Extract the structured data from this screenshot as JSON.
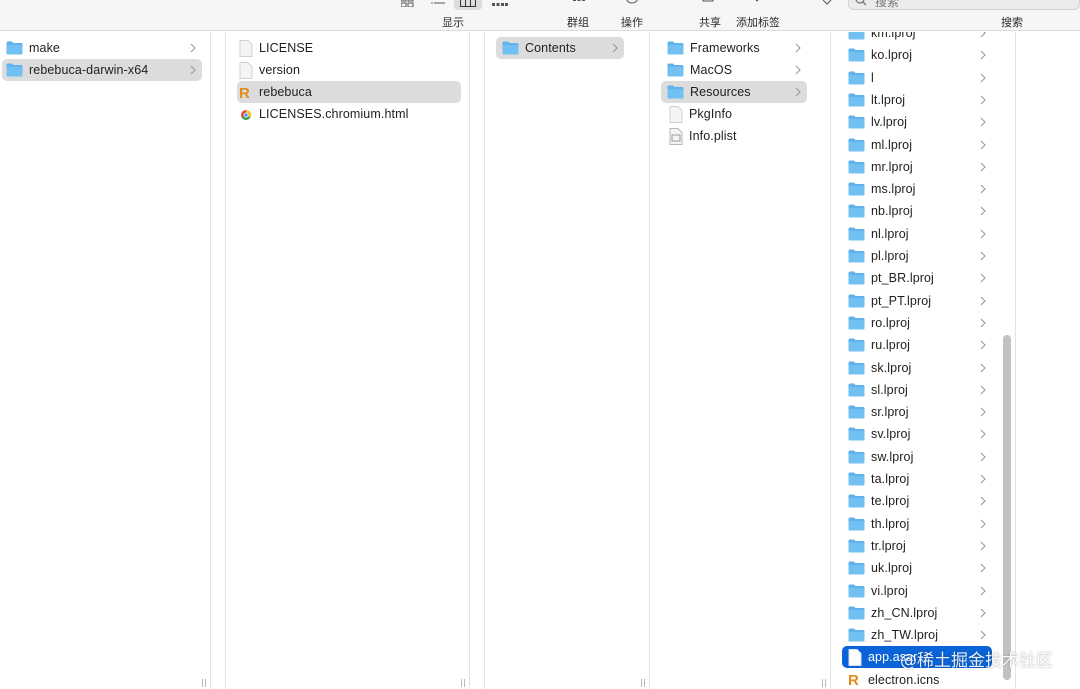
{
  "toolbar": {
    "view_label": "显示",
    "group_label": "群组",
    "action_label": "操作",
    "share_label": "共享",
    "tag_label": "添加标签",
    "search_label": "搜索",
    "search_placeholder": "搜索"
  },
  "columns": {
    "c1": [
      "make",
      "rebebuca-darwin-x64"
    ],
    "c2": [
      "LICENSE",
      "version",
      "rebebuca",
      "LICENSES.chromium.html"
    ],
    "c3": [
      "Contents"
    ],
    "c4": [
      "Frameworks",
      "MacOS",
      "Resources",
      "PkgInfo",
      "Info.plist"
    ],
    "c5": [
      "km.lproj",
      "ko.lproj",
      "l",
      "lt.lproj",
      "lv.lproj",
      "ml.lproj",
      "mr.lproj",
      "ms.lproj",
      "nb.lproj",
      "nl.lproj",
      "pl.lproj",
      "pt_BR.lproj",
      "pt_PT.lproj",
      "ro.lproj",
      "ru.lproj",
      "sk.lproj",
      "sl.lproj",
      "sr.lproj",
      "sv.lproj",
      "sw.lproj",
      "ta.lproj",
      "te.lproj",
      "th.lproj",
      "tr.lproj",
      "uk.lproj",
      "vi.lproj",
      "zh_CN.lproj",
      "zh_TW.lproj",
      "app.asar",
      "electron.icns"
    ]
  },
  "watermark": "@稀土掘金技术社区",
  "colors": {
    "folder": "#5fb2ec",
    "selection": "#0a64d8",
    "inactive_selection": "#dcdcdc"
  }
}
